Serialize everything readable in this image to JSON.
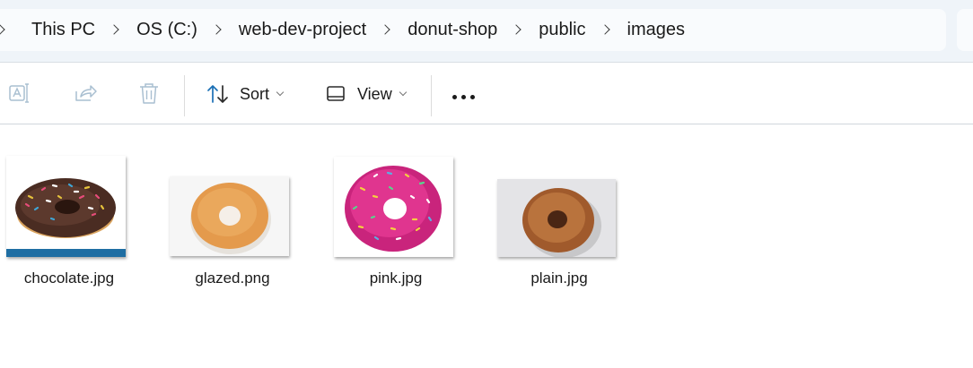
{
  "breadcrumb": {
    "items": [
      "This PC",
      "OS (C:)",
      "web-dev-project",
      "donut-shop",
      "public",
      "images"
    ]
  },
  "toolbar": {
    "sort_label": "Sort",
    "view_label": "View",
    "icons": [
      "rename-icon",
      "share-icon",
      "delete-icon",
      "sort-icon",
      "view-icon",
      "more-options-icon"
    ]
  },
  "files": [
    {
      "name": "chocolate.jpg",
      "thumbnail": "chocolate-sprinkle-donut"
    },
    {
      "name": "glazed.png",
      "thumbnail": "glazed-donut"
    },
    {
      "name": "pink.jpg",
      "thumbnail": "pink-sprinkle-donut"
    },
    {
      "name": "plain.jpg",
      "thumbnail": "sugar-donut"
    }
  ],
  "colors": {
    "address_bg": "#eff4f9",
    "toolbar_icon_disabled": "#a9bfd1",
    "sort_arrow_blue": "#1a6fb5"
  }
}
